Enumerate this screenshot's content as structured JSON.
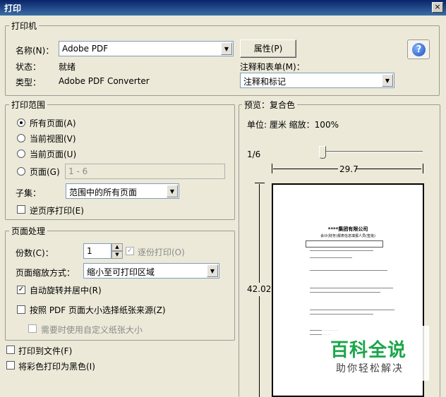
{
  "window": {
    "title": "打印",
    "close": "×"
  },
  "printer": {
    "legend": "打印机",
    "name_label": "名称(N)：",
    "name_value": "Adobe PDF",
    "status_label": "状态：",
    "status_value": "就绪",
    "type_label": "类型：",
    "type_value": "Adobe PDF Converter",
    "properties_button": "属性(P)",
    "comments_label": "注释和表单(M)：",
    "comments_value": "注释和标记",
    "help_icon": "?"
  },
  "range": {
    "legend": "打印范围",
    "all": "所有页面(A)",
    "current_view": "当前视图(V)",
    "current_page": "当前页面(U)",
    "pages": "页面(G)",
    "pages_value": "1 - 6",
    "subset_label": "子集：",
    "subset_value": "范围中的所有页面",
    "reverse": "逆页序打印(E)"
  },
  "handling": {
    "legend": "页面处理",
    "copies_label": "份数(C)：",
    "copies_value": "1",
    "collate": "逐份打印(O)",
    "scaling_label": "页面缩放方式：",
    "scaling_value": "缩小至可打印区域",
    "auto_rotate": "自动旋转并居中(R)",
    "choose_source": "按照 PDF 页面大小选择纸张来源(Z)",
    "custom_paper": "需要时使用自定义纸张大小"
  },
  "print_to_file": "打印到文件(F)",
  "print_black": "将彩色打印为黑色(I)",
  "preview": {
    "legend": "预览：复合色",
    "units": "单位: 厘米 缩放：100%",
    "page_count": "1/6",
    "width": "29.7",
    "height": "42.02",
    "doc_title": "****集团有限公司",
    "doc_subtitle": "会计(财务)报表信息填报人员(签批)"
  },
  "watermark": {
    "main": "百科全说",
    "sub": "助你轻松解决"
  },
  "colors": {
    "accent": "#0a246a",
    "watermark": "#1aa64a"
  }
}
